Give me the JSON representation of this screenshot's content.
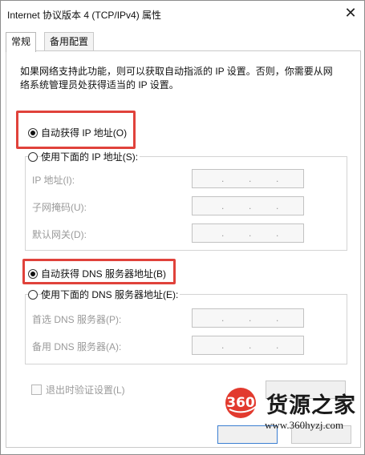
{
  "window": {
    "title": "Internet 协议版本 4 (TCP/IPv4) 属性",
    "close_glyph": "✕"
  },
  "tabs": [
    {
      "label": "常规",
      "active": true
    },
    {
      "label": "备用配置",
      "active": false
    }
  ],
  "description": "如果网络支持此功能，则可以获取自动指派的 IP 设置。否则，你需要从网络系统管理员处获得适当的 IP 设置。",
  "ip_section": {
    "auto_radio": {
      "label": "自动获得 IP 地址(O)",
      "checked": true
    },
    "manual_radio": {
      "label": "使用下面的 IP 地址(S):",
      "checked": false
    },
    "fields": [
      {
        "label": "IP 地址(I):"
      },
      {
        "label": "子网掩码(U):"
      },
      {
        "label": "默认网关(D):"
      }
    ]
  },
  "dns_section": {
    "auto_radio": {
      "label": "自动获得 DNS 服务器地址(B)",
      "checked": true
    },
    "manual_radio": {
      "label": "使用下面的 DNS 服务器地址(E):",
      "checked": false
    },
    "fields": [
      {
        "label": "首选 DNS 服务器(P):"
      },
      {
        "label": "备用 DNS 服务器(A):"
      }
    ]
  },
  "validate_checkbox": {
    "label": "退出时验证设置(L)",
    "checked": false
  },
  "watermark": {
    "logo_text": "360",
    "brand": "货源之家",
    "url": "www.360hyzj.com"
  },
  "colors": {
    "highlight": "#e0423b",
    "logo_red": "#e23a2e"
  }
}
